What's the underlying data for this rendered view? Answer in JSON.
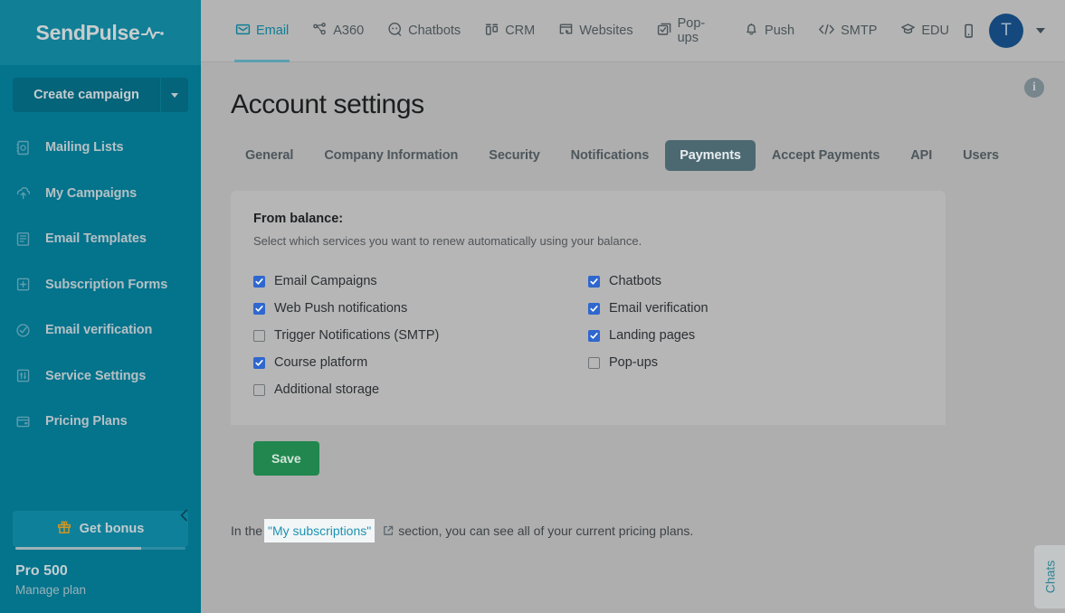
{
  "sidebar": {
    "logo_text": "SendPulse",
    "logo_icon": "pulse-wave-icon",
    "create_campaign_label": "Create campaign",
    "items": [
      {
        "label": "Mailing Lists",
        "icon": "address-book-icon"
      },
      {
        "label": "My Campaigns",
        "icon": "campaign-upload-icon"
      },
      {
        "label": "Email Templates",
        "icon": "template-icon"
      },
      {
        "label": "Subscription Forms",
        "icon": "form-plus-icon"
      },
      {
        "label": "Email verification",
        "icon": "check-circle-icon"
      },
      {
        "label": "Service Settings",
        "icon": "sliders-icon"
      },
      {
        "label": "Pricing Plans",
        "icon": "card-icon"
      }
    ],
    "bonus_label": "Get bonus",
    "bonus_icon": "gift-icon",
    "collapse_icon": "chevron-left-icon",
    "plan_name": "Pro 500",
    "plan_manage": "Manage plan",
    "plan_progress": 74
  },
  "topnav": {
    "items": [
      {
        "label": "Email",
        "icon": "envelope-icon",
        "active": true
      },
      {
        "label": "A360",
        "icon": "automation-icon",
        "active": false
      },
      {
        "label": "Chatbots",
        "icon": "chat-bot-icon",
        "active": false
      },
      {
        "label": "CRM",
        "icon": "crm-icon",
        "active": false
      },
      {
        "label": "Websites",
        "icon": "website-icon",
        "active": false
      },
      {
        "label": "Pop-ups",
        "icon": "popup-icon",
        "active": false
      },
      {
        "label": "Push",
        "icon": "bell-icon",
        "active": false
      },
      {
        "label": "SMTP",
        "icon": "code-icon",
        "active": false
      },
      {
        "label": "EDU",
        "icon": "graduation-cap-icon",
        "active": false
      }
    ],
    "mobile_icon": "mobile-phone-icon",
    "avatar_initial": "T",
    "avatar_caret_icon": "chevron-down-icon"
  },
  "page": {
    "title": "Account settings",
    "info_icon": "info-circle-icon",
    "tabs": [
      {
        "label": "General",
        "active": false
      },
      {
        "label": "Company Information",
        "active": false
      },
      {
        "label": "Security",
        "active": false
      },
      {
        "label": "Notifications",
        "active": false
      },
      {
        "label": "Payments",
        "active": true
      },
      {
        "label": "Accept Payments",
        "active": false
      },
      {
        "label": "API",
        "active": false
      },
      {
        "label": "Users",
        "active": false
      }
    ]
  },
  "card": {
    "heading": "From balance:",
    "subtitle": "Select which services you want to renew automatically using your balance.",
    "checkboxes_left": [
      {
        "label": "Email Campaigns",
        "checked": true
      },
      {
        "label": "Web Push notifications",
        "checked": true
      },
      {
        "label": "Trigger Notifications (SMTP)",
        "checked": false
      },
      {
        "label": "Course platform",
        "checked": true
      },
      {
        "label": "Additional storage",
        "checked": false
      }
    ],
    "checkboxes_right": [
      {
        "label": "Chatbots",
        "checked": true
      },
      {
        "label": "Email verification",
        "checked": true
      },
      {
        "label": "Landing pages",
        "checked": true
      },
      {
        "label": "Pop-ups",
        "checked": false
      }
    ],
    "save_label": "Save"
  },
  "footnote": {
    "prefix": "In the",
    "link_text": "\"My subscriptions\"",
    "link_icon": "external-link-icon",
    "suffix": "section, you can see all of your current pricing plans."
  },
  "chats_widget": {
    "label": "Chats"
  },
  "colors": {
    "sidebar_bg": "#04738c",
    "logo_bg": "#117f96",
    "page_bg": "#aeaeae",
    "topbar_bg": "#b4b4b4",
    "card_bg": "#b6b6b6",
    "active_tab_bg": "#4c6871",
    "accent_teal": "#0f7d96",
    "checkbox_blue": "#2f67cf",
    "save_green": "#21874e",
    "avatar_navy": "#15497d",
    "bonus_gift_orange": "#d8971f",
    "link_teal": "#1d92b0"
  }
}
